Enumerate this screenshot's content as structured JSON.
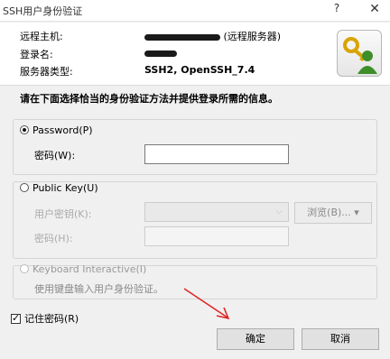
{
  "window": {
    "title": "SSH用户身份验证",
    "help": "?",
    "close": "✕"
  },
  "header": {
    "remote_host_label": "远程主机:",
    "remote_host_suffix": "(远程服务器)",
    "login_name_label": "登录名:",
    "server_type_label": "服务器类型:",
    "server_type_value": "SSH2, OpenSSH_7.4"
  },
  "instruction": "请在下面选择恰当的身份验证方法并提供登录所需的信息。",
  "password_section": {
    "radio_label": "Password(P)",
    "selected": true,
    "field_label": "密码(W):"
  },
  "publickey_section": {
    "radio_label": "Public Key(U)",
    "user_key_label": "用户密钥(K):",
    "passphrase_label": "密码(H):",
    "browse_label": "浏览(B)..."
  },
  "keyboard_section": {
    "radio_label": "Keyboard Interactive(I)",
    "hint": "使用键盘输入用户身份验证。"
  },
  "remember": {
    "label": "记住密码(R)",
    "checked": true
  },
  "buttons": {
    "ok": "确定",
    "cancel": "取消"
  }
}
